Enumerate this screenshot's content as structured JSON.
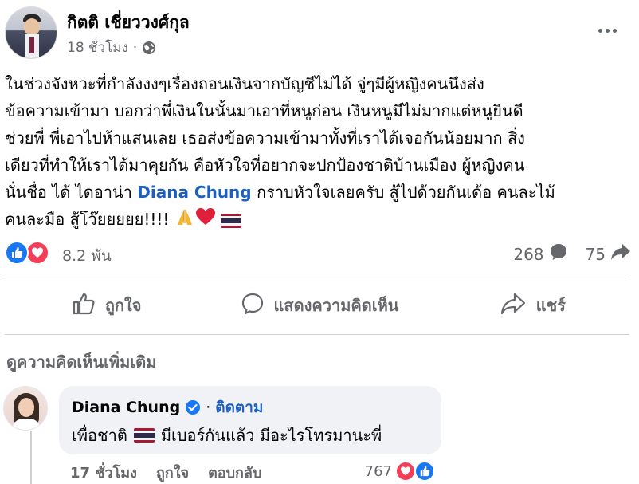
{
  "post": {
    "author_name": "กิตติ เชี่ยววงศ์กุล",
    "timestamp": "18 ชั่วโมง",
    "separator": "·",
    "body_lines": [
      "ในช่วงจังหวะที่กำลังงงๆเรื่องถอนเงินจากบัญชีไม่ได้ จู่ๆมีผู้หญิงคนนึงส่ง",
      "ข้อความเข้ามา บอกว่าพี่เงินในนั้นมาเอาที่หนูก่อน เงินหนูมีไม่มากแต่หนูยินดี",
      "ช่วยพี่ พี่เอาไปห้าแสนเลย เธอส่งข้อความเข้ามาทั้งที่เราได้เจอกันน้อยมาก สิ่ง",
      "เดียวที่ทำให้เราได้มาคุยกัน คือหัวใจที่อยากจะปกป้องชาติบ้านเมือง ผู้หญิงคน"
    ],
    "line5_before": "นั่นชื่อ ได้ ไดอาน่า ",
    "line5_mention": "Diana Chung",
    "line5_after": " กราบหัวใจเลยครับ สู้ไปด้วยกันเด้อ คนละไม้",
    "line6_text": "คนละมือ สู้โว๊ยยยยย!!!! ",
    "icons": {
      "globe": "globe-icon",
      "more": "more-options-icon",
      "pray": "pray-emoji",
      "heart": "red-heart-emoji",
      "flag": "thailand-flag-emoji"
    }
  },
  "stats": {
    "reactions_count": "8.2 พัน",
    "comments_count": "268",
    "shares_count": "75"
  },
  "actions": {
    "like_label": "ถูกใจ",
    "comment_label": "แสดงความคิดเห็น",
    "share_label": "แชร์"
  },
  "comments_section": {
    "more_comments_label": "ดูความคิดเห็นเพิ่มเติม",
    "comment": {
      "author": "Diana Chung",
      "separator": "·",
      "follow_label": "ติดตาม",
      "text_before_flag": "เพื่อชาติ",
      "text_after_flag": "มีเบอร์กันแล้ว มีอะไรโทรมานะพี่",
      "time": "17 ชั่วโมง",
      "like_label": "ถูกใจ",
      "reply_label": "ตอบกลับ",
      "reactions_count": "767"
    }
  },
  "colors": {
    "like_blue": "#1877f2",
    "love_red": "#f33e58",
    "link_blue": "#1d5fbf",
    "secondary_text": "#65676b"
  }
}
